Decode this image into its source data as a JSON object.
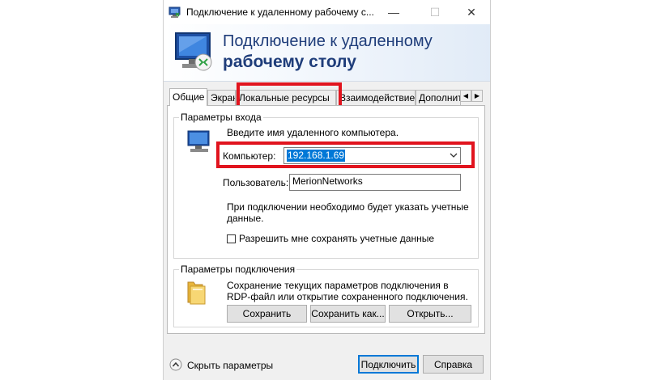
{
  "window": {
    "title": "Подключение к удаленному рабочему с...",
    "minimize": "—",
    "maximize": "☐",
    "close": "✕"
  },
  "banner": {
    "line1": "Подключение к удаленному",
    "line2": "рабочему столу"
  },
  "tabs": [
    {
      "label": "Общие"
    },
    {
      "label": "Экран"
    },
    {
      "label": "Локальные ресурсы"
    },
    {
      "label": "Взаимодействие"
    },
    {
      "label": "Дополнительно"
    }
  ],
  "login": {
    "legend": "Параметры входа",
    "hint": "Введите имя удаленного компьютера.",
    "computer_label": "Компьютер:",
    "computer_value": "192.168.1.69",
    "user_label": "Пользователь:",
    "user_value": "MerionNetworks",
    "note_line1": "При подключении необходимо будет указать учетные",
    "note_line2": "данные.",
    "save_creds_label": "Разрешить мне сохранять учетные данные"
  },
  "connection": {
    "legend": "Параметры подключения",
    "desc_line1": "Сохранение текущих параметров подключения в",
    "desc_line2": "RDP-файл или открытие сохраненного подключения.",
    "save": "Сохранить",
    "save_as": "Сохранить как...",
    "open": "Открыть..."
  },
  "footer": {
    "hide_options": "Скрыть параметры",
    "connect": "Подключить",
    "help": "Справка"
  },
  "colors": {
    "highlight_red": "#e1141e",
    "banner_text": "#1f3d7a",
    "selection": "#0078d7"
  }
}
